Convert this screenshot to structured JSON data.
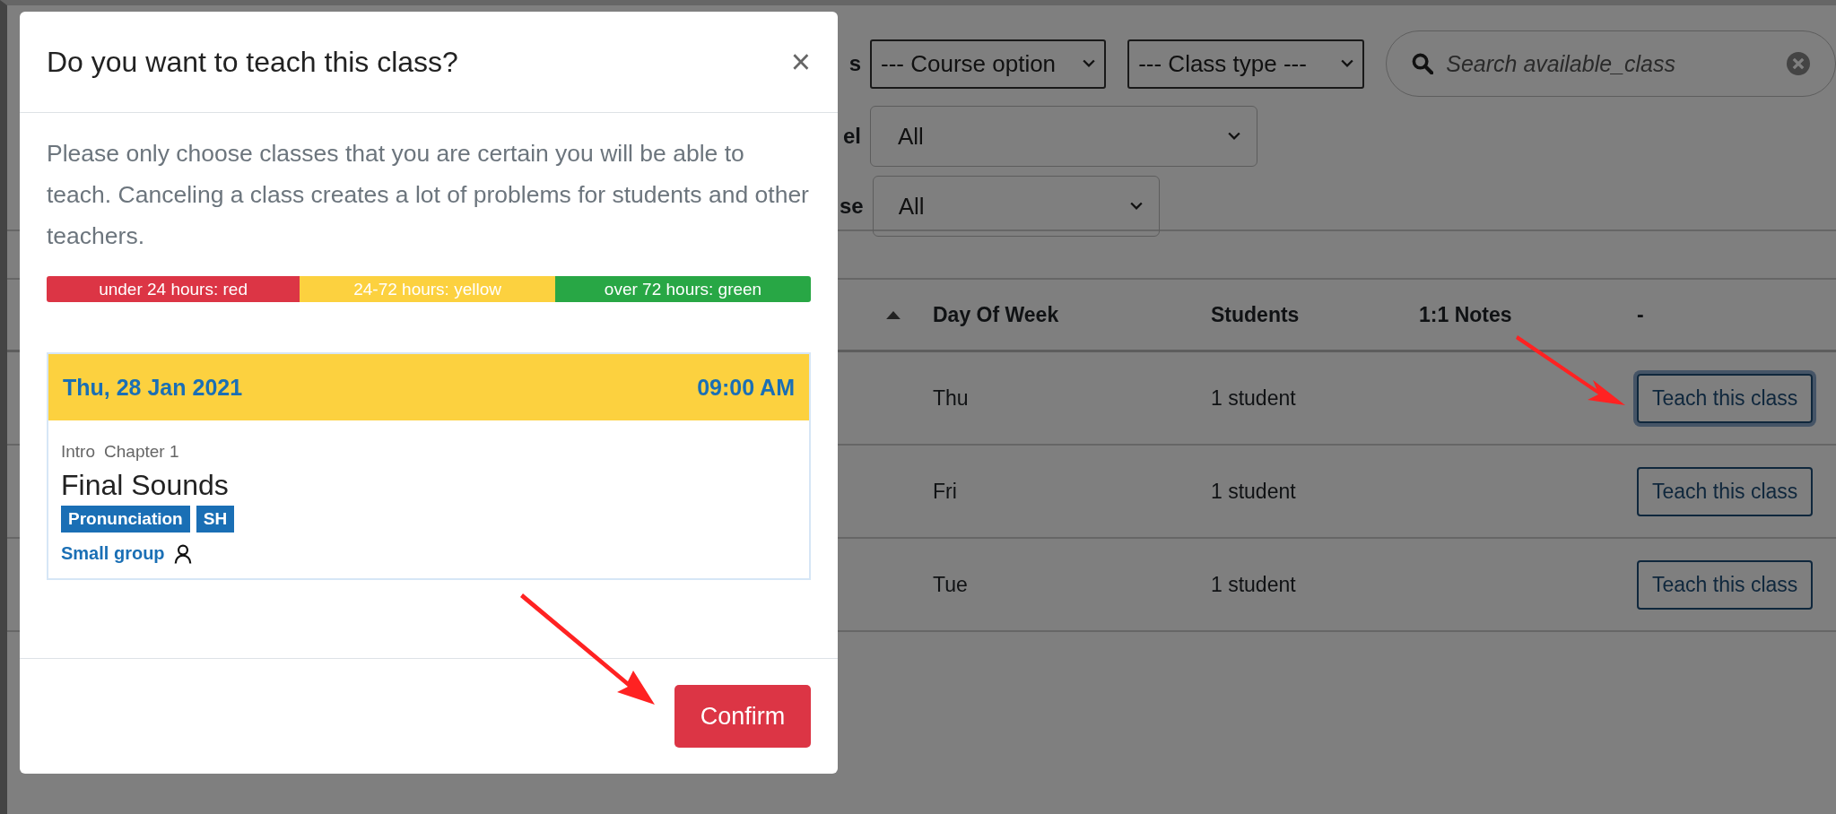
{
  "page": {
    "filters": [
      {
        "label": "s",
        "selects": [
          {
            "value": "--- Course option"
          },
          {
            "value": "--- Class type ---"
          }
        ],
        "search": {
          "placeholder": "Search available_class"
        }
      },
      {
        "label": "el",
        "selects": [
          {
            "value": "All"
          }
        ]
      },
      {
        "label": "se",
        "selects": [
          {
            "value": "All"
          }
        ]
      }
    ],
    "table": {
      "columns": [
        "Day Of Week",
        "Students",
        "1:1 Notes",
        "-"
      ],
      "rows": [
        {
          "day": "Thu",
          "students": "1 student",
          "action": "Teach this class",
          "focused": true
        },
        {
          "day": "Fri",
          "students": "1 student",
          "action": "Teach this class",
          "focused": false
        },
        {
          "day": "Tue",
          "students": "1 student",
          "action": "Teach this class",
          "focused": false
        }
      ]
    }
  },
  "modal": {
    "title": "Do you want to teach this class?",
    "close": "×",
    "message": "Please only choose classes that you are certain you will be able to teach. Canceling a class creates a lot of problems for students and other teachers.",
    "legend": [
      {
        "label": "under 24 hours: red",
        "color": "#dc3545"
      },
      {
        "label": "24-72 hours: yellow",
        "color": "#fcd13f"
      },
      {
        "label": "over 72 hours: green",
        "color": "#28a745"
      }
    ],
    "class_card": {
      "date": "Thu, 28 Jan 2021",
      "time": "09:00 AM",
      "color": "#fcd13f",
      "course": "Intro",
      "chapter": "Chapter 1",
      "title": "Final Sounds",
      "tags": [
        "Pronunciation",
        "SH"
      ],
      "group": "Small group"
    },
    "confirm": "Confirm"
  }
}
